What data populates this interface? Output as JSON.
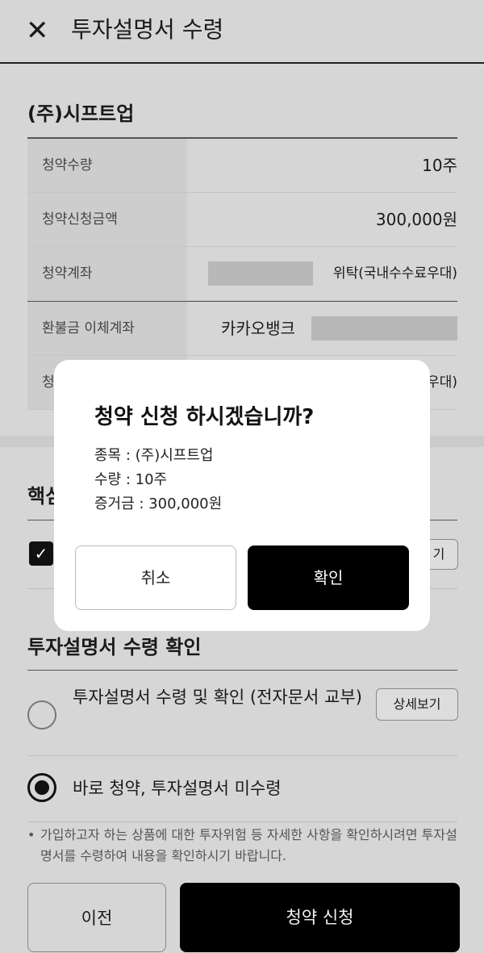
{
  "header": {
    "title": "투자설명서 수령",
    "close_icon": "close-icon"
  },
  "company": "(주)시프트업",
  "info_rows": [
    {
      "label": "청약수량",
      "value": "10주"
    },
    {
      "label": "청약신청금액",
      "value": "300,000원"
    },
    {
      "label": "청약계좌",
      "value": "위탁(국내수수료우대)"
    },
    {
      "label": "환불금 이체계좌",
      "value": "카카오뱅크"
    },
    {
      "label": "청",
      "value": "우대)"
    }
  ],
  "core_section": {
    "title": "핵심",
    "detail_button": "기"
  },
  "prospectus": {
    "title": "투자설명서 수령 확인",
    "option1": "투자설명서 수령 및 확인 (전자문서 교부)",
    "option1_detail": "상세보기",
    "option2": "바로 청약, 투자설명서 미수령",
    "note": "가입하고자 하는 상품에 대한 투자위험 등 자세한 사항을 확인하시려면 투자설명서를 수령하여 내용을 확인하시기 바랍니다."
  },
  "bottom": {
    "prev": "이전",
    "apply": "청약 신청"
  },
  "modal": {
    "title": "청약 신청 하시겠습니까?",
    "line1": "종목 : (주)시프트업",
    "line2": "수량 : 10주",
    "line3": "증거금 : 300,000원",
    "cancel": "취소",
    "ok": "확인"
  }
}
